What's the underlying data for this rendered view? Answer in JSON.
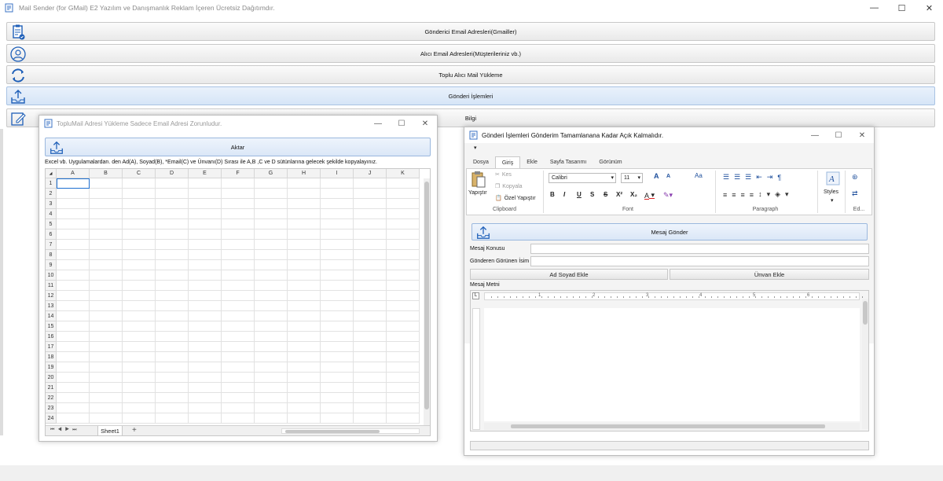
{
  "app": {
    "title": "Mail Sender (for GMail) E2 Yazılım ve Danışmanlık Reklam İçeren Ücretsiz Dağıtımdır.",
    "minimize": "—",
    "maximize": "☐",
    "close": "✕"
  },
  "nav": [
    {
      "label": "Gönderici Email Adresleri(Gmailler)",
      "icon": "clipboard-check-icon"
    },
    {
      "label": "Alıcı Email Adresleri(Müşterileriniz vb.)",
      "icon": "user-circle-icon"
    },
    {
      "label": "Toplu Alıcı Mail Yükleme",
      "icon": "refresh-icon"
    },
    {
      "label": "Gönderi İşlemleri",
      "icon": "upload-tray-icon"
    },
    {
      "label": "Bilgi",
      "icon": "edit-note-icon"
    }
  ],
  "bulk_window": {
    "title": "TopluMail Adresi Yükleme Sadece Email Adresi Zorunludur.",
    "import_button": "Aktar",
    "instructions": "Excel vb. Uygulamalardan. den Ad(A), Soyad(B), *Email(C) ve Ünvanı(D) Sırası ile A,B ,C ve D sütünlarına gelecek şekilde kopyalayınız.",
    "columns": [
      "A",
      "B",
      "C",
      "D",
      "E",
      "F",
      "G",
      "H",
      "I",
      "J",
      "K"
    ],
    "rows": [
      "1",
      "2",
      "3",
      "4",
      "5",
      "6",
      "7",
      "8",
      "9",
      "10",
      "11",
      "12",
      "13",
      "14",
      "15",
      "16",
      "17",
      "18",
      "19",
      "20",
      "21",
      "22",
      "23",
      "24"
    ],
    "sheet_tab": "Sheet1",
    "add_sheet": "+",
    "nav_arrows": [
      "⏮",
      "◀",
      "▶",
      "⏭"
    ]
  },
  "send_window": {
    "title": "Gönderi İşlemleri Gönderim Tamamlanana Kadar Açık Kalmalıdır.",
    "tabs": [
      "Dosya",
      "Giriş",
      "Ekle",
      "Sayfa Tasarımı",
      "Görünüm"
    ],
    "active_tab": "Giriş",
    "clipboard": {
      "paste": "Yapıştır",
      "cut": "Kes",
      "copy": "Kopyala",
      "paste_special": "Özel Yapıştır",
      "group": "Clipboard"
    },
    "font": {
      "family": "Calibri",
      "size": "11",
      "group": "Font",
      "bold": "B",
      "italic": "I",
      "underline": "U",
      "strike": "S",
      "strike2": "S",
      "superscript": "X²",
      "subscript": "X₂",
      "grow": "A",
      "shrink": "A",
      "case": "Aa"
    },
    "paragraph": {
      "group": "Paragraph",
      "pilcrow": "¶"
    },
    "styles": {
      "label": "Styles"
    },
    "editing": {
      "group": "Ed..."
    },
    "send_button": "Mesaj Gönder",
    "subject_label": "Mesaj Konusu",
    "sender_label": "Gönderen Görünen İsim",
    "add_name_button": "Ad Soyad Ekle",
    "add_title_button": "Ünvan Ekle",
    "body_label": "Mesaj Metni",
    "ruler_numbers": [
      "1",
      "2",
      "3",
      "4",
      "5",
      "6"
    ],
    "ruler_corner": "L"
  }
}
